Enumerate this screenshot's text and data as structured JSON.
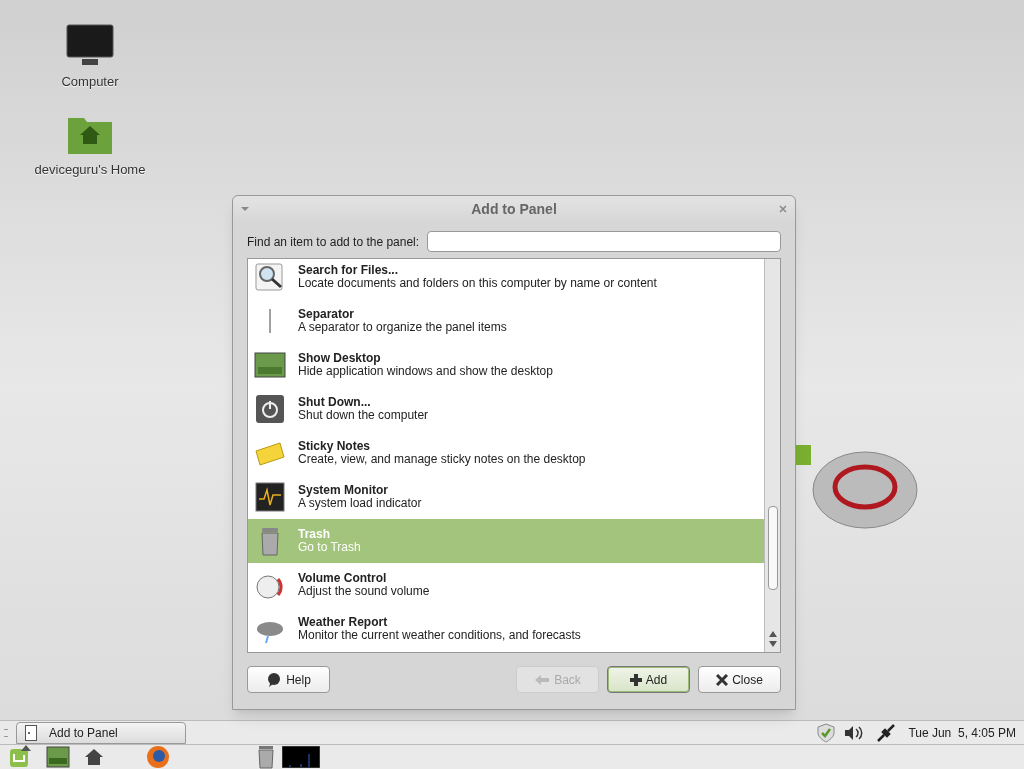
{
  "desktop_icons": [
    {
      "kind": "computer",
      "label": "Computer"
    },
    {
      "kind": "home",
      "label": "deviceguru's Home"
    }
  ],
  "dialog": {
    "title": "Add to Panel",
    "search": {
      "label": "Find an item to add to the panel:"
    },
    "items": [
      {
        "kind": "search",
        "name": "Search for Files...",
        "description": "Locate documents and folders on this computer by name or content",
        "selected": false
      },
      {
        "kind": "separator",
        "name": "Separator",
        "description": "A separator to organize the panel items",
        "selected": false
      },
      {
        "kind": "desktop",
        "name": "Show Desktop",
        "description": "Hide application windows and show the desktop",
        "selected": false
      },
      {
        "kind": "shutdown",
        "name": "Shut Down...",
        "description": "Shut down the computer",
        "selected": false
      },
      {
        "kind": "notes",
        "name": "Sticky Notes",
        "description": "Create, view, and manage sticky notes on the desktop",
        "selected": false
      },
      {
        "kind": "monitor",
        "name": "System Monitor",
        "description": "A system load indicator",
        "selected": false
      },
      {
        "kind": "trash",
        "name": "Trash",
        "description": "Go to Trash",
        "selected": true
      },
      {
        "kind": "volume",
        "name": "Volume Control",
        "description": "Adjust the sound volume",
        "selected": false
      },
      {
        "kind": "weather",
        "name": "Weather Report",
        "description": "Monitor the current weather conditions, and forecasts",
        "selected": false
      }
    ],
    "buttons": [
      {
        "kind": "help",
        "label": "Help",
        "disabled": false,
        "default": false
      },
      {
        "kind": "back",
        "label": "Back",
        "disabled": true,
        "default": false
      },
      {
        "kind": "add",
        "label": "Add",
        "disabled": false,
        "default": true
      },
      {
        "kind": "close",
        "label": "Close",
        "disabled": false,
        "default": false
      }
    ]
  },
  "taskbar": {
    "windows": [
      {
        "label": "Add to Panel"
      }
    ],
    "clock": "Tue Jun  5, 4:05 PM"
  }
}
